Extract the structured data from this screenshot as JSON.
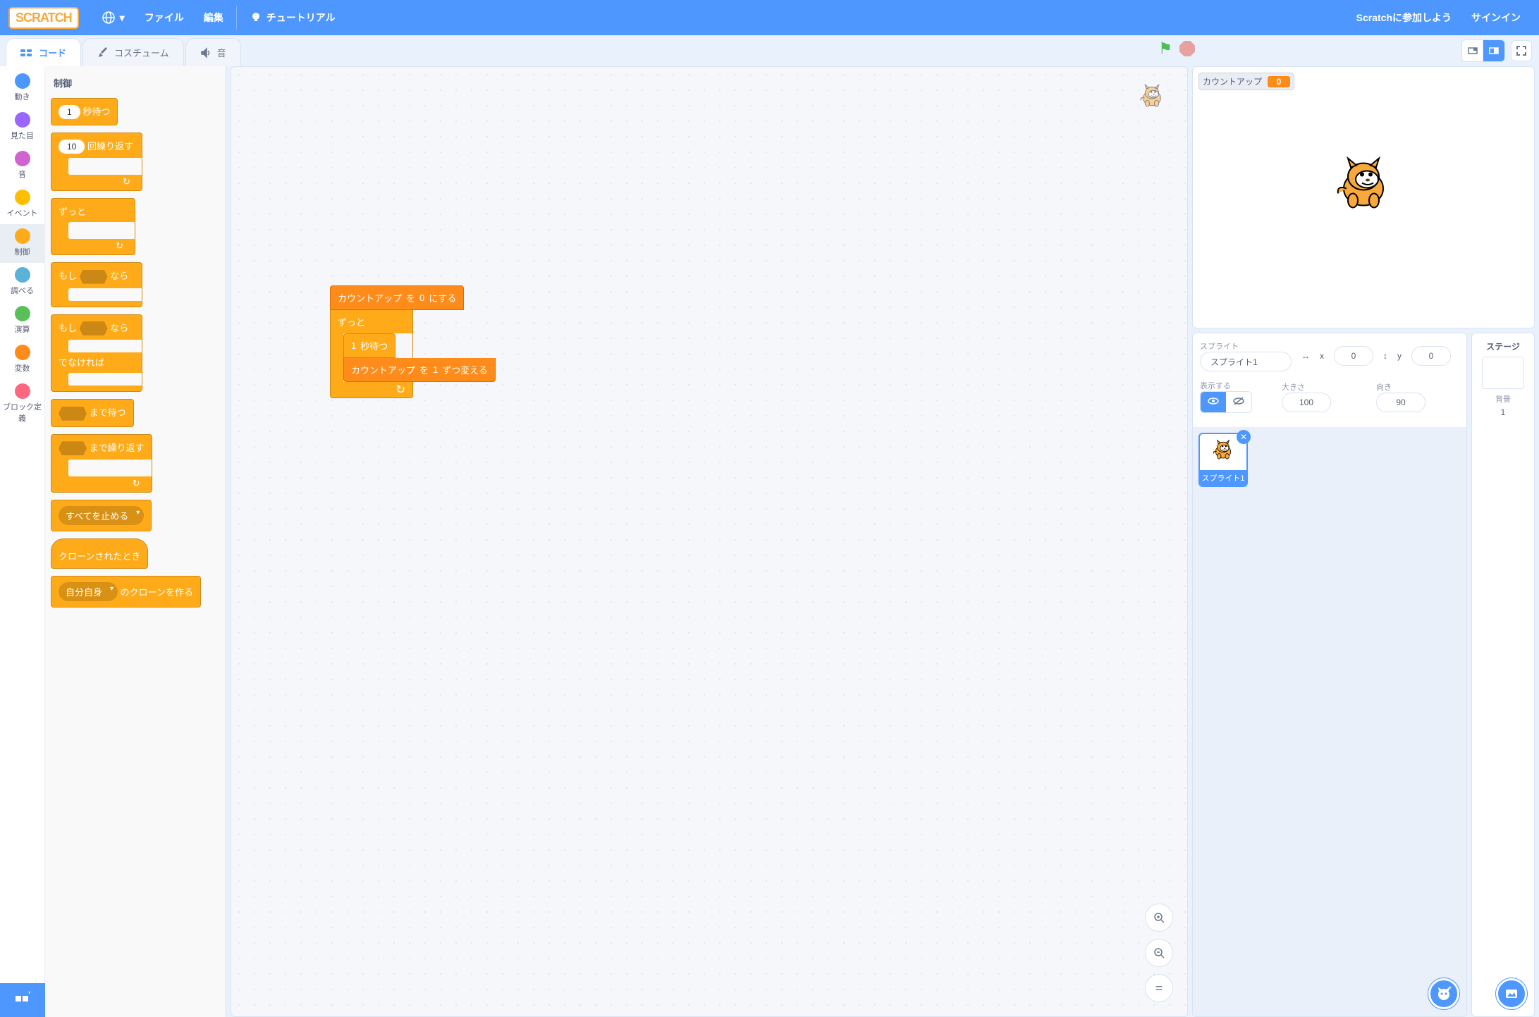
{
  "menubar": {
    "logo": "SCRATCH",
    "file": "ファイル",
    "edit": "編集",
    "tutorials": "チュートリアル",
    "join": "Scratchに参加しよう",
    "signin": "サインイン"
  },
  "tabs": {
    "code": "コード",
    "costumes": "コスチューム",
    "sounds": "音"
  },
  "categories": [
    {
      "name": "動き",
      "color": "#4c97ff"
    },
    {
      "name": "見た目",
      "color": "#9966ff"
    },
    {
      "name": "音",
      "color": "#cf63cf"
    },
    {
      "name": "イベント",
      "color": "#ffbf00"
    },
    {
      "name": "制御",
      "color": "#ffab19"
    },
    {
      "name": "調べる",
      "color": "#5cb1d6"
    },
    {
      "name": "演算",
      "color": "#59c059"
    },
    {
      "name": "変数",
      "color": "#ff8c1a"
    },
    {
      "name": "ブロック定義",
      "color": "#ff6680"
    }
  ],
  "palette": {
    "header": "制御",
    "wait_val": "1",
    "wait_label": "秒待つ",
    "repeat_val": "10",
    "repeat_label": "回繰り返す",
    "forever": "ずっと",
    "if": "もし",
    "then": "なら",
    "else": "でなければ",
    "wait_until": "まで待つ",
    "repeat_until": "まで繰り返す",
    "stop_all": "すべてを止める",
    "when_clone": "クローンされたとき",
    "create_clone_self": "自分自身",
    "create_clone_suffix": "のクローンを作る"
  },
  "workspace": {
    "set_var": "カウントアップ",
    "set_to": "を",
    "set_val": "0",
    "set_suffix": "にする",
    "forever": "ずっと",
    "wait_val": "1",
    "wait_label": "秒待つ",
    "change_var": "カウントアップ",
    "change_to": "を",
    "change_val": "1",
    "change_suffix": "ずつ変える"
  },
  "stage": {
    "monitor_name": "カウントアップ",
    "monitor_val": "0"
  },
  "sprite_info": {
    "label_sprite": "スプライト",
    "name": "スプライト1",
    "x_label": "x",
    "x_val": "0",
    "y_label": "y",
    "y_val": "0",
    "show_label": "表示する",
    "size_label": "大きさ",
    "size_val": "100",
    "dir_label": "向き",
    "dir_val": "90",
    "tile_name": "スプライト1"
  },
  "stage_panel": {
    "title": "ステージ",
    "backdrops_label": "背景",
    "backdrops_count": "1"
  }
}
